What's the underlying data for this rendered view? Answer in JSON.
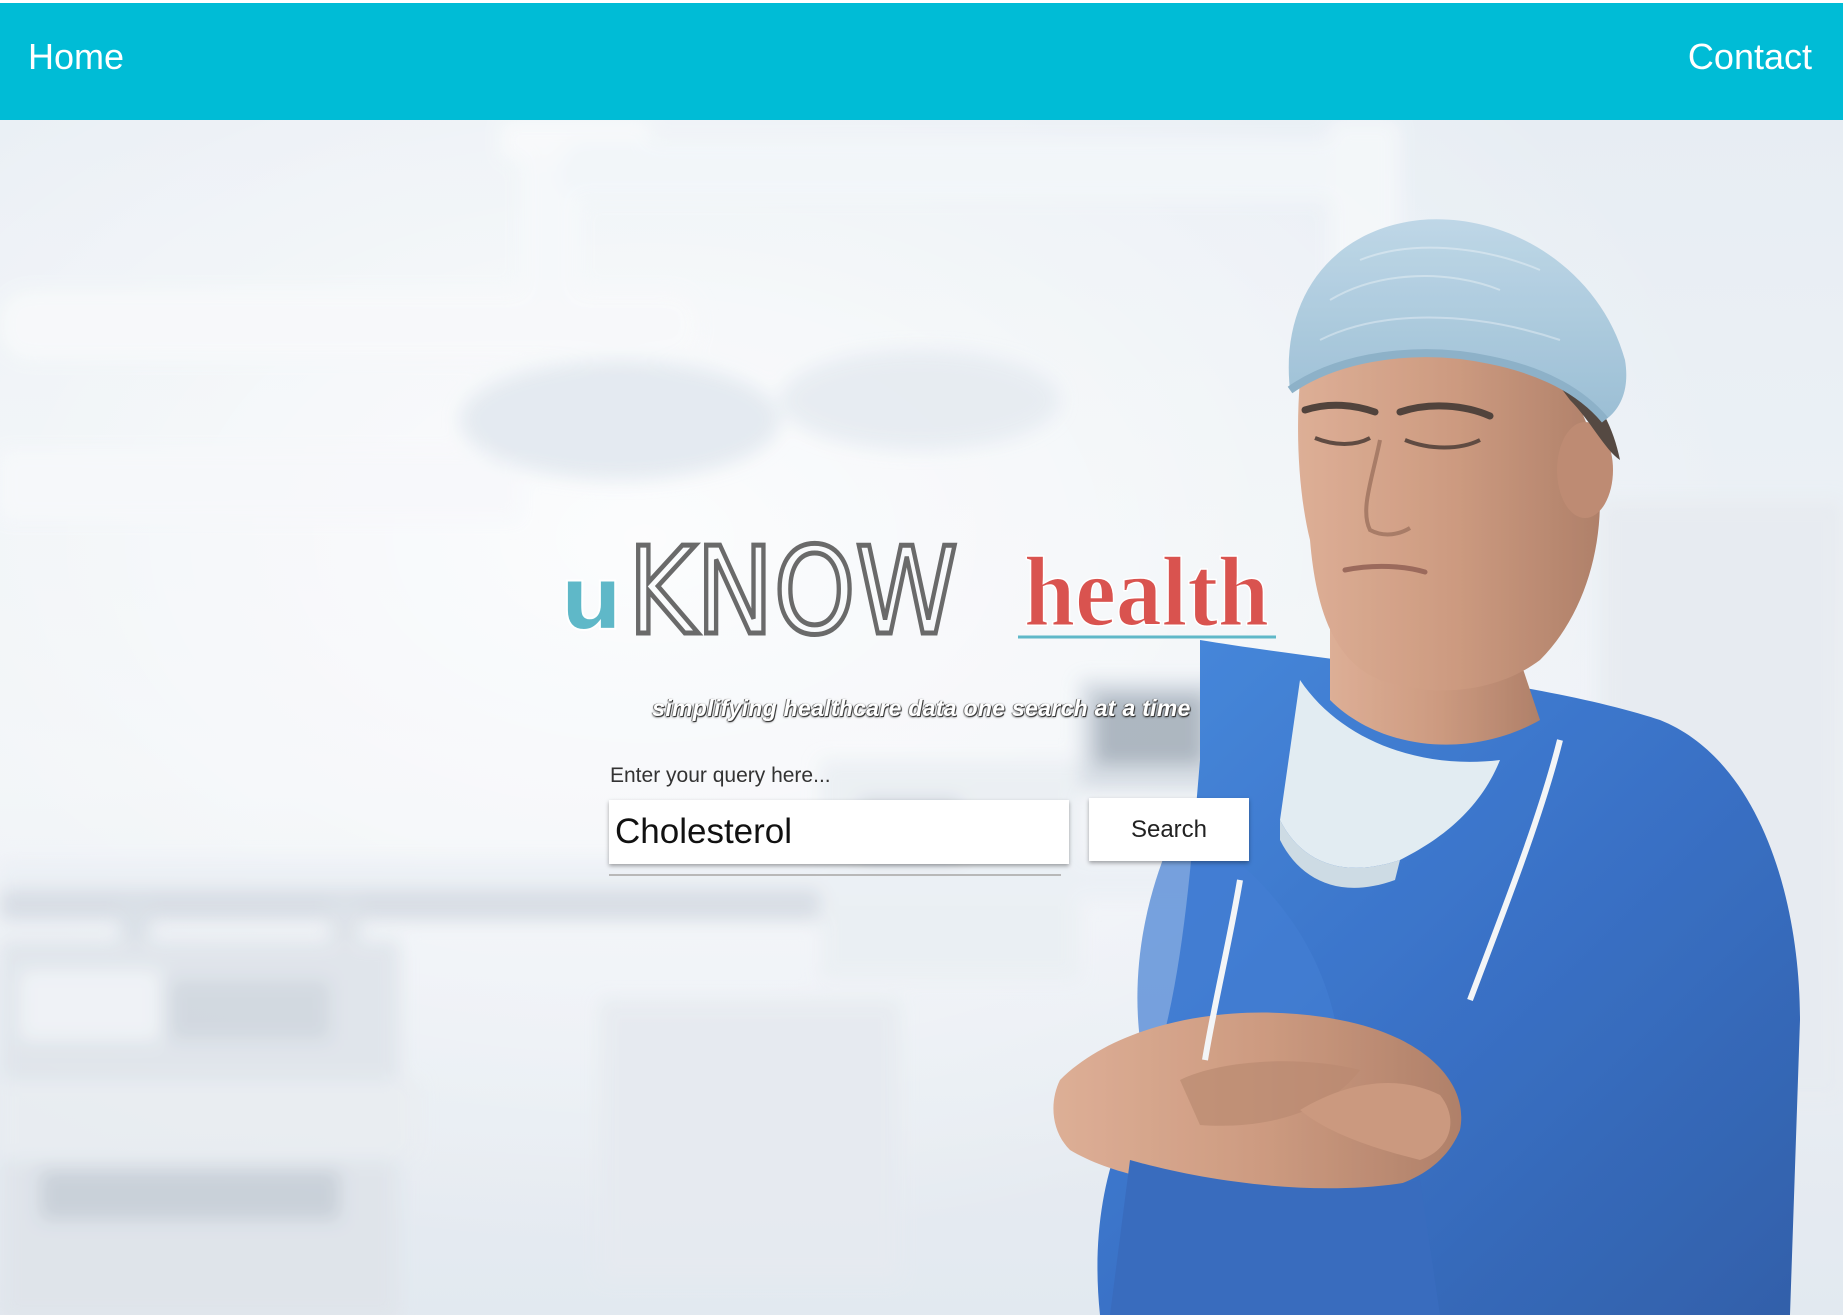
{
  "nav": {
    "home_label": "Home",
    "contact_label": "Contact"
  },
  "brand": {
    "logo_u": "u",
    "logo_know": "KNOW",
    "logo_health": "health",
    "tagline": "simplifying healthcare data one search at a time"
  },
  "search": {
    "label": "Enter your query here...",
    "value": "Cholesterol",
    "button_label": "Search"
  },
  "colors": {
    "nav_bg": "#00bcd6",
    "logo_u": "#5fb8c8",
    "logo_know": "#6a6a6a",
    "logo_health": "#d9534f",
    "scrubs": "#1f5fc0"
  }
}
